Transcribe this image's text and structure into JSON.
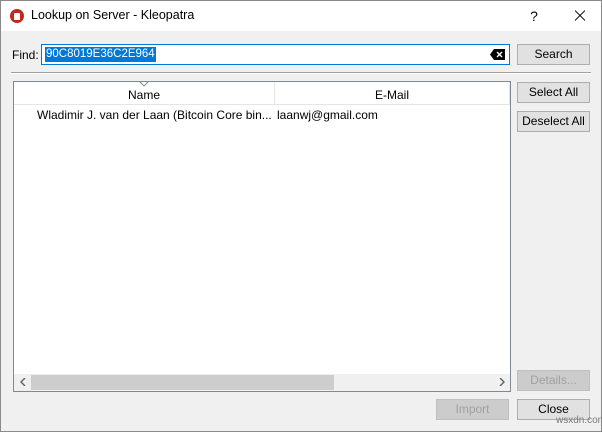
{
  "window": {
    "title": "Lookup on Server - Kleopatra",
    "help_label": "?"
  },
  "find": {
    "label": "Find:",
    "value": "90C8019E36C2E964"
  },
  "buttons": {
    "search": "Search",
    "select_all": "Select All",
    "deselect_all": "Deselect All",
    "details": "Details...",
    "import": "Import",
    "close": "Close"
  },
  "table": {
    "columns": [
      "Name",
      "E-Mail"
    ],
    "rows": [
      {
        "name": "Wladimir J. van der Laan (Bitcoin Core bin...",
        "email": "laanwj@gmail.com"
      }
    ]
  },
  "watermark": "wsxdn.com",
  "colors": {
    "accent": "#0078d7",
    "app_icon": "#c4281c"
  }
}
